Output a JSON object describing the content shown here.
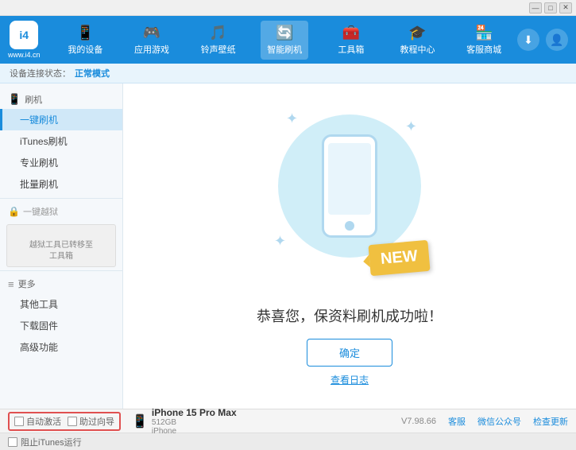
{
  "window": {
    "top_buttons": [
      "▾",
      "—",
      "□",
      "✕"
    ]
  },
  "header": {
    "logo_text": "www.i4.cn",
    "logo_short": "i4",
    "nav_items": [
      {
        "id": "my-device",
        "icon": "📱",
        "label": "我的设备"
      },
      {
        "id": "apps-games",
        "icon": "🎮",
        "label": "应用游戏"
      },
      {
        "id": "ringtones",
        "icon": "🎵",
        "label": "铃声壁纸"
      },
      {
        "id": "smart-flash",
        "icon": "🔄",
        "label": "智能刷机",
        "active": true
      },
      {
        "id": "toolbox",
        "icon": "🧰",
        "label": "工具箱"
      },
      {
        "id": "tutorial",
        "icon": "🎓",
        "label": "教程中心"
      },
      {
        "id": "service",
        "icon": "🏪",
        "label": "客服商城"
      }
    ],
    "right_buttons": [
      {
        "id": "download",
        "icon": "⬇"
      },
      {
        "id": "user",
        "icon": "👤"
      }
    ]
  },
  "status_bar": {
    "prefix": "设备连接状态：",
    "status": "正常模式"
  },
  "sidebar": {
    "sections": [
      {
        "id": "flash",
        "icon": "📱",
        "label": "刷机",
        "items": [
          {
            "id": "onekey-flash",
            "label": "一键刷机",
            "active": true
          },
          {
            "id": "itunes-flash",
            "label": "iTunes刷机"
          },
          {
            "id": "pro-flash",
            "label": "专业刷机"
          },
          {
            "id": "batch-flash",
            "label": "批量刷机"
          }
        ]
      },
      {
        "id": "onekey-state",
        "icon": "🔒",
        "label": "一键越狱",
        "disabled": true,
        "notice": "越狱工具已转移至\n工具箱"
      },
      {
        "id": "more",
        "icon": "≡",
        "label": "更多",
        "items": [
          {
            "id": "other-tools",
            "label": "其他工具"
          },
          {
            "id": "download-fw",
            "label": "下载固件"
          },
          {
            "id": "advanced",
            "label": "高级功能"
          }
        ]
      }
    ]
  },
  "content": {
    "success_title": "恭喜您，保资料刷机成功啦！",
    "confirm_btn": "确定",
    "log_link": "查看日志",
    "new_badge": "NEW"
  },
  "bottom": {
    "auto_activate": "自动激活",
    "guided_activate": "助过向导",
    "device_icon": "📱",
    "device_name": "iPhone 15 Pro Max",
    "device_storage": "512GB",
    "device_type": "iPhone",
    "version": "V7.98.66",
    "links": [
      "客服",
      "微信公众号",
      "检查更新"
    ],
    "itunes_label": "阻止iTunes运行"
  }
}
